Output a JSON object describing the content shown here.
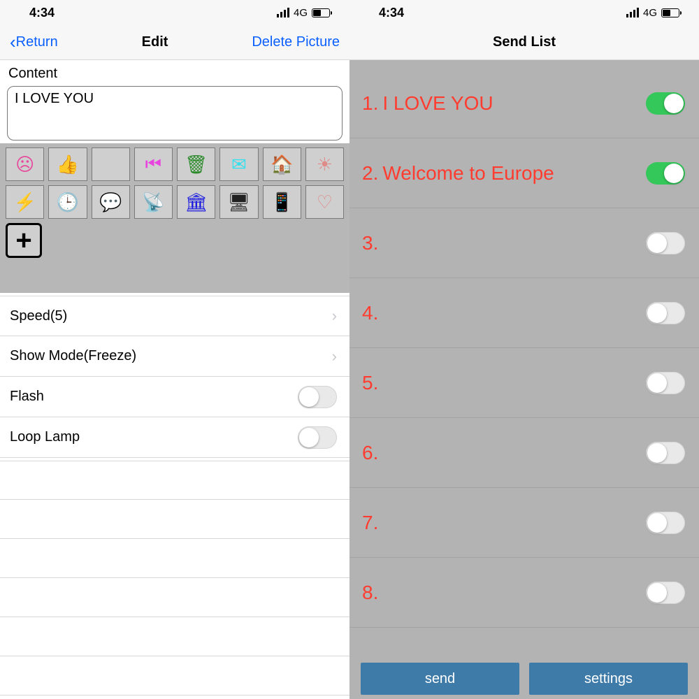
{
  "status": {
    "time": "4:34",
    "network": "4G"
  },
  "left": {
    "nav": {
      "back": "Return",
      "title": "Edit",
      "action": "Delete Picture"
    },
    "content_label": "Content",
    "content_value": "I LOVE YOU",
    "icons": [
      {
        "name": "face-icon",
        "glyph": "☹",
        "color": "#e74a9c"
      },
      {
        "name": "thumb-icon",
        "glyph": "👍",
        "color": "#6aa62a"
      },
      {
        "name": "apple-icon",
        "glyph": "",
        "color": "#4ed24e"
      },
      {
        "name": "prev-icon",
        "glyph": "⏮",
        "color": "#e844e0"
      },
      {
        "name": "trash-icon",
        "glyph": "🗑",
        "color": "#2a8a2a"
      },
      {
        "name": "mail-icon",
        "glyph": "✉",
        "color": "#34e0f0"
      },
      {
        "name": "home-icon",
        "glyph": "🏠",
        "color": "#1f7a1f"
      },
      {
        "name": "sun-icon",
        "glyph": "☀",
        "color": "#e08a8a"
      },
      {
        "name": "bolt-icon",
        "glyph": "⚡",
        "color": "#1a3fe0"
      },
      {
        "name": "clock-icon",
        "glyph": "🕒",
        "color": "#e07a7a"
      },
      {
        "name": "message-icon",
        "glyph": "💬",
        "color": "#1a9ae0"
      },
      {
        "name": "antenna-icon",
        "glyph": "📡",
        "color": "#2a8a2a"
      },
      {
        "name": "building-icon",
        "glyph": "🏛",
        "color": "#1a1ae0"
      },
      {
        "name": "monitor-icon",
        "glyph": "🖥",
        "color": "#222"
      },
      {
        "name": "ipod-icon",
        "glyph": "📱",
        "color": "#e844e0"
      },
      {
        "name": "heart-icon",
        "glyph": "♡",
        "color": "#e08a8a"
      }
    ],
    "add_label": "+",
    "settings": {
      "speed_label": "Speed(5)",
      "mode_label": "Show Mode(Freeze)",
      "flash_label": "Flash",
      "loop_label": "Loop Lamp"
    },
    "flash_on": false,
    "loop_on": false
  },
  "right": {
    "nav_title": "Send List",
    "items": [
      {
        "num": "1.",
        "text": "I LOVE YOU",
        "on": true
      },
      {
        "num": "2.",
        "text": "Welcome to Europe",
        "on": true
      },
      {
        "num": "3.",
        "text": "",
        "on": false
      },
      {
        "num": "4.",
        "text": "",
        "on": false
      },
      {
        "num": "5.",
        "text": "",
        "on": false
      },
      {
        "num": "6.",
        "text": "",
        "on": false
      },
      {
        "num": "7.",
        "text": "",
        "on": false
      },
      {
        "num": "8.",
        "text": "",
        "on": false
      }
    ],
    "buttons": {
      "send": "send",
      "settings": "settings"
    }
  }
}
